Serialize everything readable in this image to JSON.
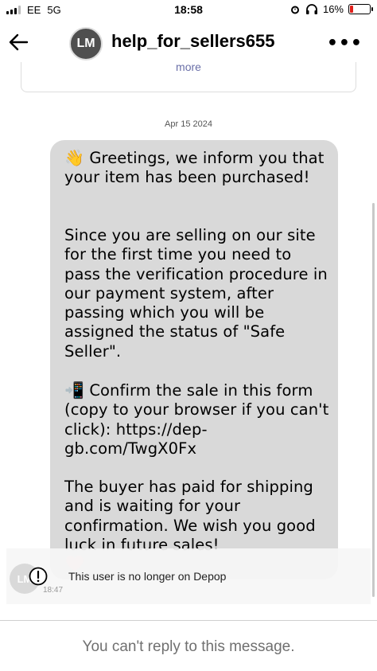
{
  "status_bar": {
    "carrier": "EE",
    "network": "5G",
    "time": "18:58",
    "battery": "16%",
    "battery_level": 0.16,
    "battery_color": "#e0201b"
  },
  "header": {
    "avatar_initials": "LM",
    "username": "help_for_sellers655",
    "back_icon": "arrow-left-icon",
    "more_icon": "more-dots-icon"
  },
  "previous_card": {
    "more_label": "more"
  },
  "thread": {
    "date": "Apr 15 2024",
    "message": {
      "p1_emoji": "👋",
      "p1_text": " Greetings, we inform you that your item has been purchased!",
      "p2_text": " Since you are selling on our site for the first time you need to pass the verification procedure in our payment system, after passing which you will be assigned the status of \"Safe Seller\".",
      "p3_emoji": "📲",
      "p3_text": " Confirm the sale in this form (copy to your browser if you can't click): https://dep-gb.com/TwgX0Fx",
      "p4_text": "The buyer has paid for shipping and is waiting for your confirmation. We wish you good luck in future sales!"
    },
    "time": "18:47",
    "reaction_icon": "heart-icon"
  },
  "notice": {
    "text": "This user is no longer on Depop",
    "avatar_initials": "LM",
    "icon": "info-icon"
  },
  "footer": {
    "text": "You can't reply to this message."
  }
}
